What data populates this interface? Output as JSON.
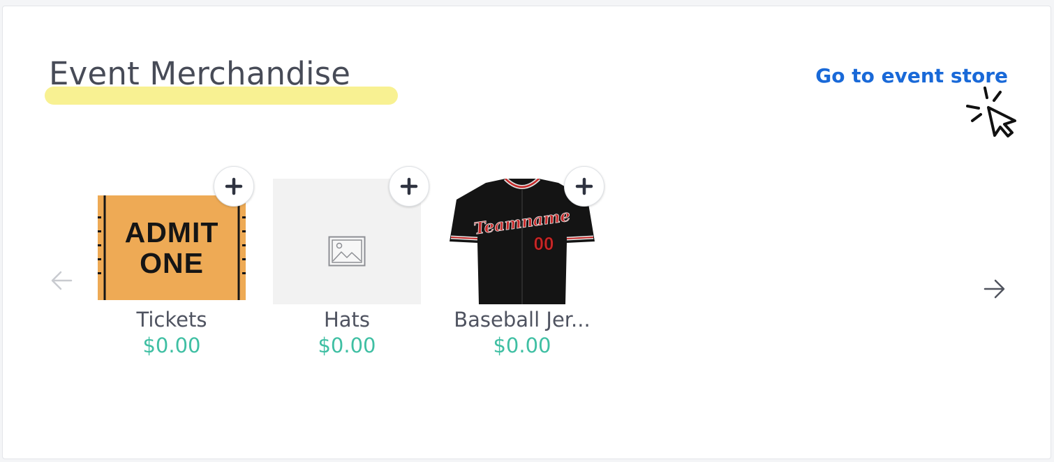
{
  "section": {
    "title": "Event Merchandise",
    "store_link": "Go to event store"
  },
  "carousel": {
    "items": [
      {
        "name": "Tickets",
        "price": "$0.00",
        "image_text": [
          "ADMIT",
          "ONE"
        ]
      },
      {
        "name": "Hats",
        "price": "$0.00"
      },
      {
        "name": "Baseball Jer...",
        "price": "$0.00",
        "image_text": [
          "Teamname",
          "00"
        ]
      }
    ]
  },
  "icons": {
    "previous": "arrow-left-icon",
    "next": "arrow-right-icon",
    "add": "plus-icon",
    "cursor": "pointer-click-icon",
    "placeholder": "image-placeholder-icon"
  },
  "colors": {
    "title": "#474b57",
    "highlight": "#f8f192",
    "link": "#1969d8",
    "price": "#3fbfa3",
    "ticket": "#eeaa55"
  }
}
